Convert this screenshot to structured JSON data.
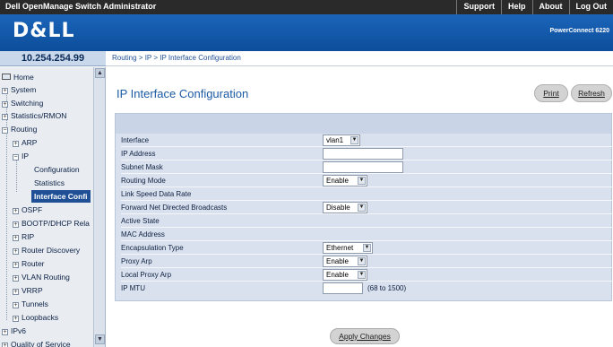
{
  "app": {
    "title": "Dell OpenManage Switch Administrator",
    "top_links": [
      "Support",
      "Help",
      "About",
      "Log Out"
    ],
    "brand": "D&LL",
    "product": "PowerConnect 6220"
  },
  "device_ip": "10.254.254.99",
  "breadcrumb": "Routing > IP > IP Interface Configuration",
  "nav": {
    "home": "Home",
    "system": "System",
    "switching": "Switching",
    "statistics": "Statistics/RMON",
    "routing": "Routing",
    "arp": "ARP",
    "ip": "IP",
    "configuration": "Configuration",
    "ip_statistics": "Statistics",
    "interface_config": "Interface Confi",
    "ospf": "OSPF",
    "bootp": "BOOTP/DHCP Rela",
    "rip": "RIP",
    "router_discovery": "Router Discovery",
    "router": "Router",
    "vlan_routing": "VLAN Routing",
    "vrrp": "VRRP",
    "tunnels": "Tunnels",
    "loopbacks": "Loopbacks",
    "ipv6": "IPv6",
    "qos": "Quality of Service"
  },
  "page": {
    "title": "IP Interface Configuration",
    "print_label": "Print",
    "refresh_label": "Refresh",
    "apply_label": "Apply Changes"
  },
  "form": {
    "interface_label": "Interface",
    "interface_value": "vlan1",
    "ip_address_label": "IP Address",
    "ip_address_value": "",
    "subnet_mask_label": "Subnet Mask",
    "subnet_mask_value": "",
    "routing_mode_label": "Routing Mode",
    "routing_mode_value": "Enable",
    "link_speed_label": "Link Speed Data Rate",
    "fwd_broadcasts_label": "Forward Net Directed Broadcasts",
    "fwd_broadcasts_value": "Disable",
    "active_state_label": "Active State",
    "mac_address_label": "MAC Address",
    "encapsulation_label": "Encapsulation Type",
    "encapsulation_value": "Ethernet",
    "proxy_arp_label": "Proxy Arp",
    "proxy_arp_value": "Enable",
    "local_proxy_arp_label": "Local Proxy Arp",
    "local_proxy_arp_value": "Enable",
    "ip_mtu_label": "IP MTU",
    "ip_mtu_value": "",
    "ip_mtu_hint": "(68 to 1500)"
  },
  "colors": {
    "brand_blue": "#1b65b9",
    "nav_selected": "#1f4f95",
    "panel_bg": "#d9e1ee",
    "title_blue": "#1b5aa5"
  }
}
